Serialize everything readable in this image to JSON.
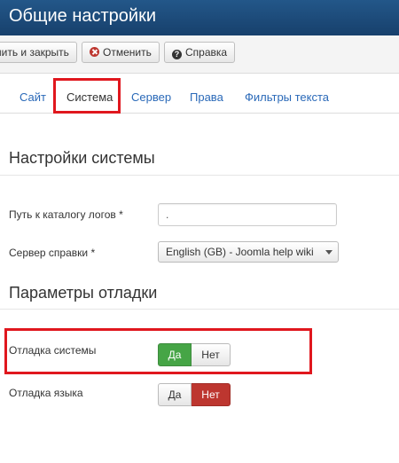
{
  "header": {
    "title": "Общие настройки"
  },
  "toolbar": {
    "save_close_label": "нить и закрыть",
    "cancel_label": "Отменить",
    "help_label": "Справка"
  },
  "tabs": [
    {
      "label": "Сайт"
    },
    {
      "label": "Система",
      "active": true
    },
    {
      "label": "Сервер"
    },
    {
      "label": "Права"
    },
    {
      "label": "Фильтры текста"
    }
  ],
  "system_settings": {
    "title": "Настройки системы",
    "log_path": {
      "label": "Путь к каталогу логов *",
      "value": "."
    },
    "help_server": {
      "label": "Сервер справки *",
      "value": "English (GB) - Joomla help wiki"
    }
  },
  "debug": {
    "title": "Параметры отладки",
    "system_debug": {
      "label": "Отладка системы",
      "yes": "Да",
      "no": "Нет",
      "selected": "yes"
    },
    "language_debug": {
      "label": "Отладка языка",
      "yes": "Да",
      "no": "Нет",
      "selected": "no"
    }
  },
  "colors": {
    "header_bg": "#1b4b7d",
    "link": "#2a69b8",
    "highlight": "#e0171e",
    "toggle_yes": "#46a546",
    "toggle_no": "#bd362f"
  }
}
